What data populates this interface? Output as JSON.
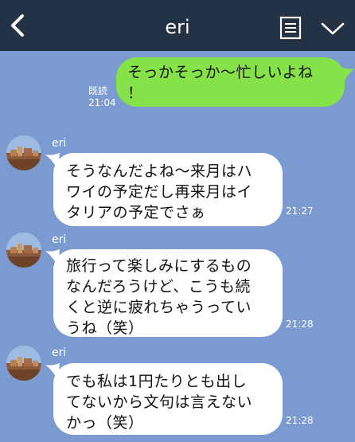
{
  "header": {
    "title": "eri",
    "back_icon": "chevron-left-icon",
    "memo_icon": "note-icon",
    "menu_icon": "chevron-down-icon"
  },
  "colors": {
    "header_bg": "#243246",
    "chat_bg": "#7b9ad0",
    "my_bubble": "#85e249",
    "their_bubble": "#ffffff"
  },
  "messages": [
    {
      "from": "me",
      "lines": [
        "そっかそっか〜忙しいよね",
        "！"
      ],
      "read": "既読",
      "time": "21:04"
    },
    {
      "from": "eri",
      "sender": "eri",
      "lines": [
        "そうなんだよね〜来月はハ",
        "ワイの予定だし再来月はイ",
        "タリアの予定でさぁ"
      ],
      "time": "21:27"
    },
    {
      "from": "eri",
      "sender": "eri",
      "lines": [
        "旅行って楽しみにするもの",
        "なんだろうけど、こうも続",
        "くと逆に疲れちゃうってい",
        "うね（笑）"
      ],
      "time": "21:28"
    },
    {
      "from": "eri",
      "sender": "eri",
      "lines": [
        "でも私は1円たりとも出し",
        "てないから文句は言えない",
        "かっ（笑）"
      ],
      "time": "21:28"
    }
  ]
}
